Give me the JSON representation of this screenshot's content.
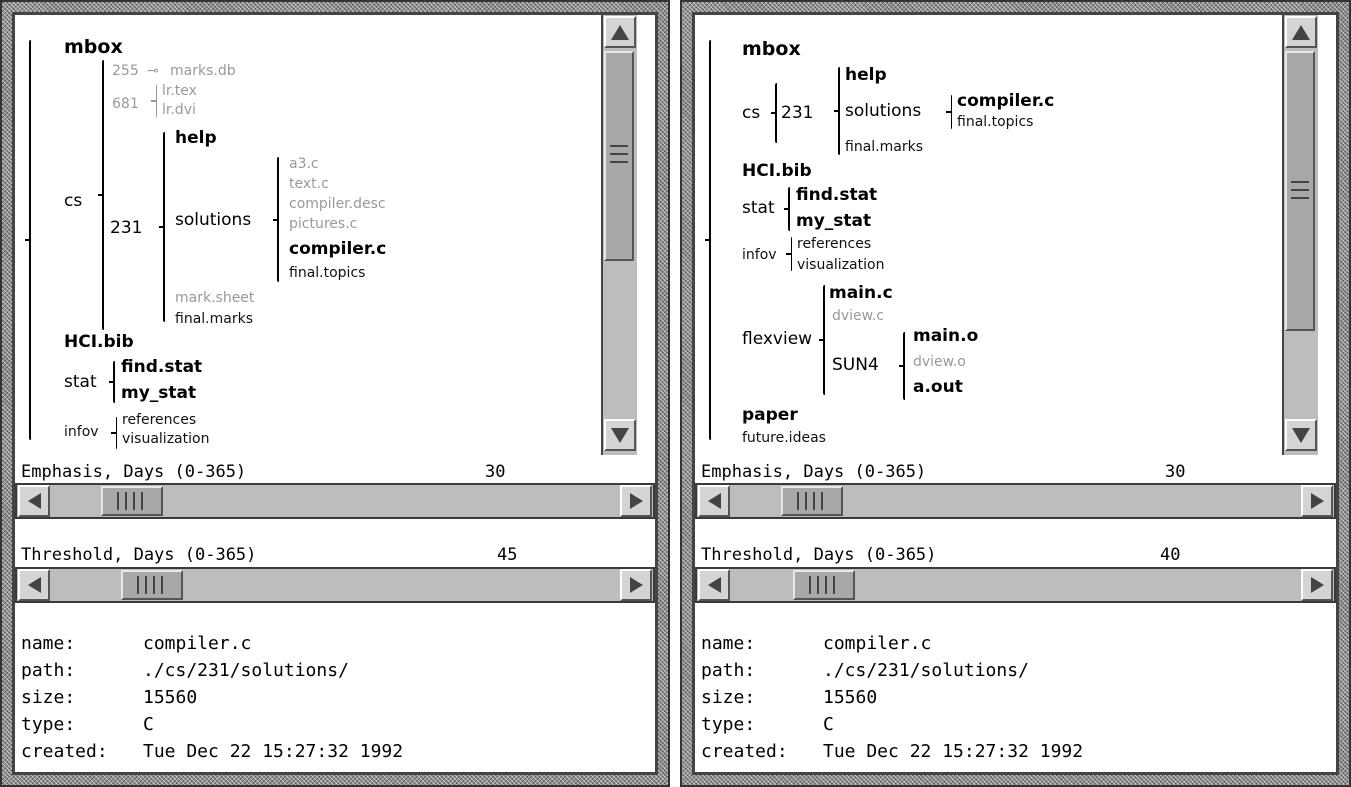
{
  "left": {
    "tree": {
      "mbox": "mbox",
      "cs": "cs",
      "n255": "255",
      "marks_db": "marks.db",
      "n681": "681",
      "lr_tex": "lr.tex",
      "lr_dvi": "lr.dvi",
      "n231": "231",
      "help": "help",
      "solutions": "solutions",
      "a3_c": "a3.c",
      "text_c": "text.c",
      "compiler_desc": "compiler.desc",
      "pictures_c": "pictures.c",
      "compiler_c": "compiler.c",
      "final_topics": "final.topics",
      "mark_sheet": "mark.sheet",
      "final_marks": "final.marks",
      "hci_bib": "HCI.bib",
      "stat": "stat",
      "find_stat": "find.stat",
      "my_stat": "my_stat",
      "infov": "infov",
      "references": "references",
      "visualization": "visualization"
    },
    "emphasis": {
      "label": "Emphasis, Days (0-365)",
      "value": "30"
    },
    "threshold": {
      "label": "Threshold, Days (0-365)",
      "value": "45"
    },
    "info": {
      "name_key": "name:",
      "name_val": "compiler.c",
      "path_key": "path:",
      "path_val": "./cs/231/solutions/",
      "size_key": "size:",
      "size_val": "15560",
      "type_key": "type:",
      "type_val": "C",
      "created_key": "created:",
      "created_val": "Tue Dec 22 15:27:32 1992"
    }
  },
  "right": {
    "tree": {
      "mbox": "mbox",
      "cs": "cs",
      "n231": "231",
      "help": "help",
      "solutions": "solutions",
      "compiler_c": "compiler.c",
      "final_topics": "final.topics",
      "final_marks": "final.marks",
      "hci_bib": "HCI.bib",
      "stat": "stat",
      "find_stat": "find.stat",
      "my_stat": "my_stat",
      "infov": "infov",
      "references": "references",
      "visualization": "visualization",
      "flexview": "flexview",
      "main_c": "main.c",
      "dview_c": "dview.c",
      "sun4": "SUN4",
      "main_o": "main.o",
      "dview_o": "dview.o",
      "a_out": "a.out",
      "paper": "paper",
      "future_ideas": "future.ideas"
    },
    "emphasis": {
      "label": "Emphasis, Days (0-365)",
      "value": "30"
    },
    "threshold": {
      "label": "Threshold, Days (0-365)",
      "value": "40"
    },
    "info": {
      "name_key": "name:",
      "name_val": "compiler.c",
      "path_key": "path:",
      "path_val": "./cs/231/solutions/",
      "size_key": "size:",
      "size_val": "15560",
      "type_key": "type:",
      "type_val": "C",
      "created_key": "created:",
      "created_val": "Tue Dec 22 15:27:32 1992"
    }
  }
}
